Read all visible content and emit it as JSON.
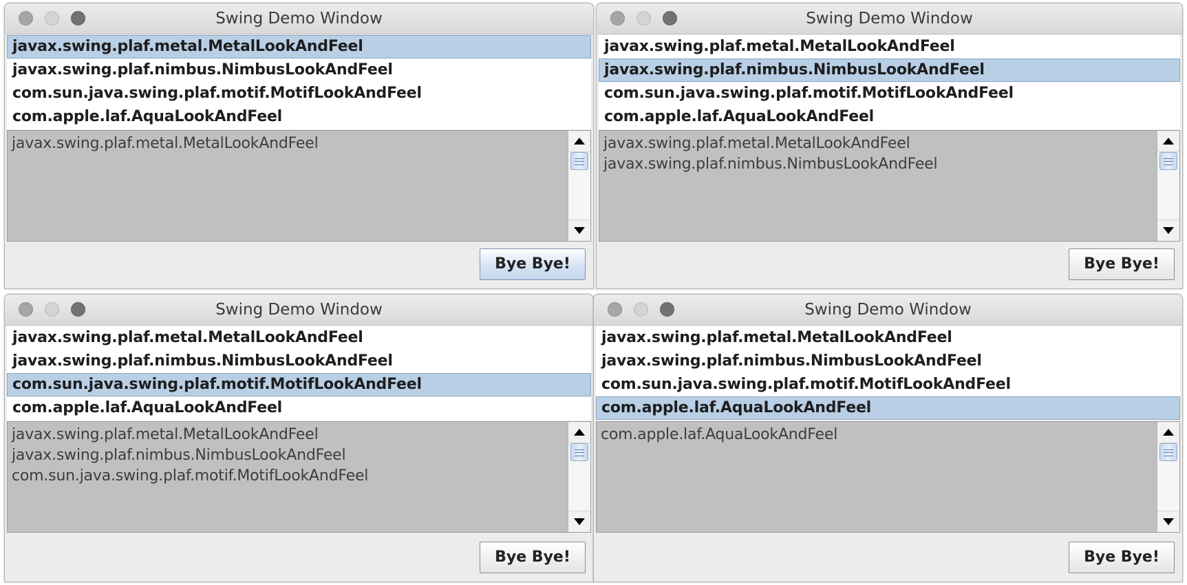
{
  "windows": [
    {
      "title": "Swing Demo Window",
      "list_items": [
        "javax.swing.plaf.metal.MetalLookAndFeel",
        "javax.swing.plaf.nimbus.NimbusLookAndFeel",
        "com.sun.java.swing.plaf.motif.MotifLookAndFeel",
        "com.apple.laf.AquaLookAndFeel"
      ],
      "selected_index": 0,
      "log_lines": [
        "javax.swing.plaf.metal.MetalLookAndFeel",
        "",
        ""
      ],
      "button_label": "Bye Bye!"
    },
    {
      "title": "Swing Demo Window",
      "list_items": [
        "javax.swing.plaf.metal.MetalLookAndFeel",
        "javax.swing.plaf.nimbus.NimbusLookAndFeel",
        "com.sun.java.swing.plaf.motif.MotifLookAndFeel",
        "com.apple.laf.AquaLookAndFeel"
      ],
      "selected_index": 1,
      "log_lines": [
        "javax.swing.plaf.metal.MetalLookAndFeel",
        "javax.swing.plaf.nimbus.NimbusLookAndFeel",
        ""
      ],
      "button_label": "Bye Bye!"
    },
    {
      "title": "Swing Demo Window",
      "list_items": [
        "javax.swing.plaf.metal.MetalLookAndFeel",
        "javax.swing.plaf.nimbus.NimbusLookAndFeel",
        "com.sun.java.swing.plaf.motif.MotifLookAndFeel",
        "com.apple.laf.AquaLookAndFeel"
      ],
      "selected_index": 2,
      "log_lines": [
        "javax.swing.plaf.metal.MetalLookAndFeel",
        "javax.swing.plaf.nimbus.NimbusLookAndFeel",
        "com.sun.java.swing.plaf.motif.MotifLookAndFeel"
      ],
      "button_label": "Bye Bye!"
    },
    {
      "title": "Swing Demo Window",
      "list_items": [
        "javax.swing.plaf.metal.MetalLookAndFeel",
        "javax.swing.plaf.nimbus.NimbusLookAndFeel",
        "com.sun.java.swing.plaf.motif.MotifLookAndFeel",
        "com.apple.laf.AquaLookAndFeel"
      ],
      "selected_index": 3,
      "log_lines": [
        "com.apple.laf.AquaLookAndFeel",
        "",
        ""
      ],
      "button_label": "Bye Bye!"
    }
  ],
  "colors": {
    "selection": "#b8cfe5",
    "text_area_bg": "#c0c0c0",
    "window_bg": "#ececec"
  }
}
